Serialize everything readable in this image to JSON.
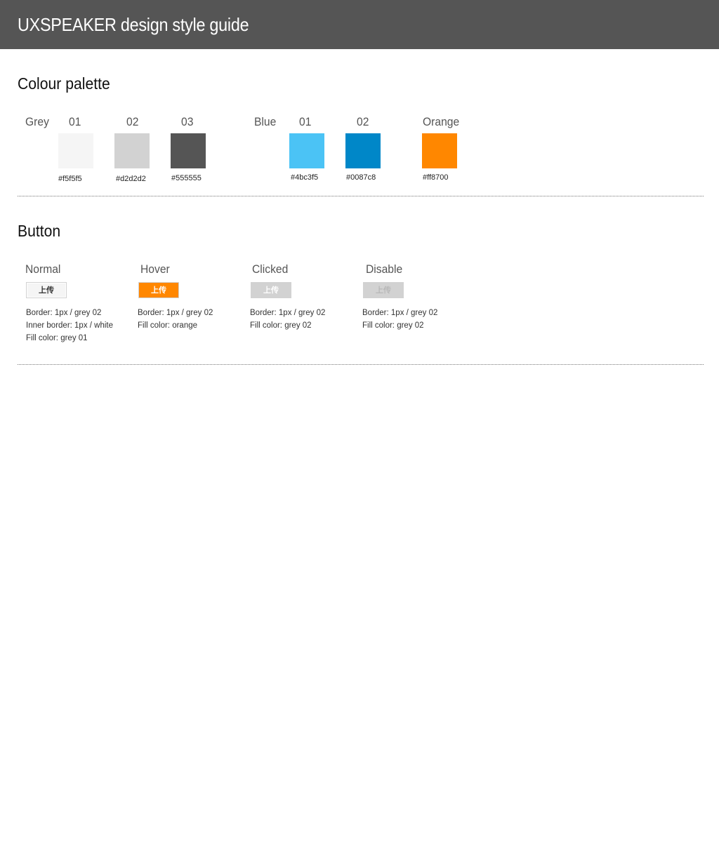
{
  "header": {
    "title": "UXSPEAKER design style guide",
    "background": "#555555"
  },
  "palette": {
    "title": "Colour palette",
    "grey": {
      "label": "Grey",
      "swatches": [
        {
          "name": "01",
          "hex": "#f5f5f5",
          "color": "#f5f5f5"
        },
        {
          "name": "02",
          "hex": "#d2d2d2",
          "color": "#d2d2d2"
        },
        {
          "name": "03",
          "hex": "#555555",
          "color": "#555555"
        }
      ]
    },
    "blue": {
      "label": "Blue",
      "swatches": [
        {
          "name": "01",
          "hex": "#4bc3f5",
          "color": "#4bc3f5"
        },
        {
          "name": "02",
          "hex": "#0087c8",
          "color": "#0087c8"
        }
      ]
    },
    "orange": {
      "label": "Orange",
      "hex": "#ff8700",
      "color": "#ff8700"
    }
  },
  "buttons": {
    "title": "Button",
    "states": [
      {
        "label": "Normal",
        "button_text": "上传",
        "desc": [
          "Border: 1px / grey 02",
          "Inner border: 1px / white",
          "Fill color: grey 01"
        ]
      },
      {
        "label": "Hover",
        "button_text": "上传",
        "desc": [
          "Border: 1px / grey 02",
          "Fill color: orange"
        ]
      },
      {
        "label": "Clicked",
        "button_text": "上传",
        "desc": [
          "Border: 1px / grey 02",
          "Fill color: grey 02"
        ]
      },
      {
        "label": "Disable",
        "button_text": "上传",
        "desc": [
          "Border: 1px / grey 02",
          "Fill color: grey 02"
        ]
      }
    ]
  }
}
